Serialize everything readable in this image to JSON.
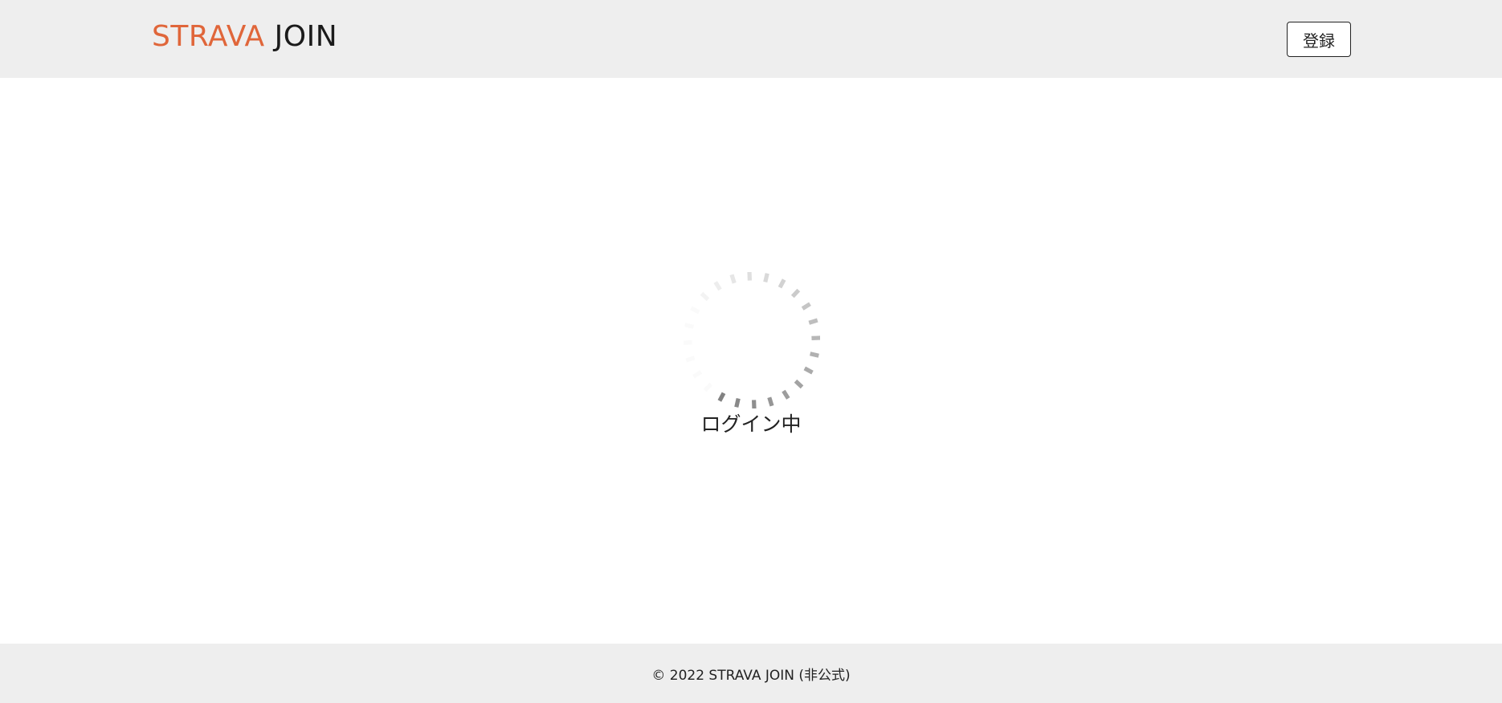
{
  "header": {
    "brand_strava": "STRAVA",
    "brand_join": "JOIN",
    "register_label": "登録"
  },
  "main": {
    "loading_label": "ログイン中"
  },
  "footer": {
    "copyright": "© 2022 STRAVA JOIN (非公式)"
  },
  "colors": {
    "brand_accent": "#e0663a",
    "bar_background": "#eeeeee"
  },
  "icons": {
    "spinner": "loading-spinner-icon"
  }
}
